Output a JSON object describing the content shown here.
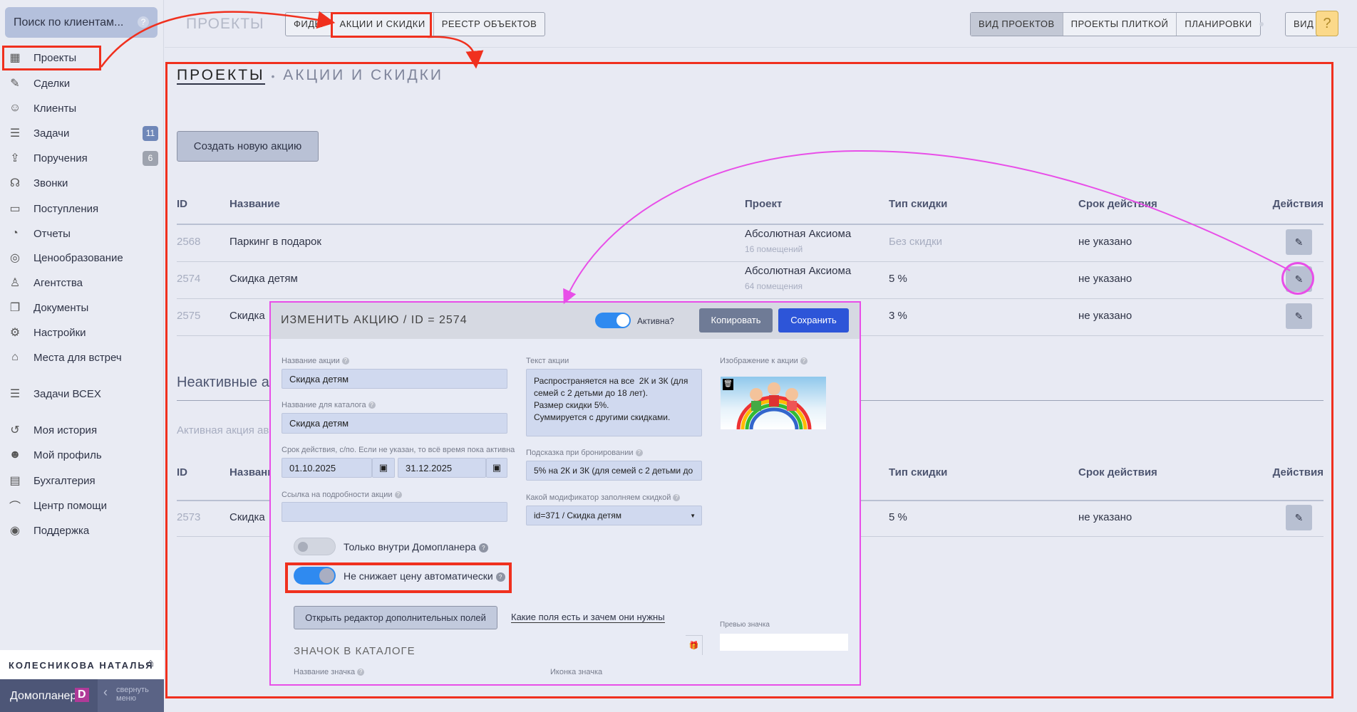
{
  "sidebar": {
    "search_placeholder": "Поиск по клиентам...",
    "items": [
      {
        "label": "Проекты",
        "icon": "building-icon"
      },
      {
        "label": "Сделки",
        "icon": "deal-icon"
      },
      {
        "label": "Клиенты",
        "icon": "users-icon"
      },
      {
        "label": "Задачи",
        "icon": "tasks-icon",
        "badge": "11"
      },
      {
        "label": "Поручения",
        "icon": "upload-icon",
        "badge": "6"
      },
      {
        "label": "Звонки",
        "icon": "headset-icon"
      },
      {
        "label": "Поступления",
        "icon": "wallet-icon"
      },
      {
        "label": "Отчеты",
        "icon": "pie-chart-icon"
      },
      {
        "label": "Ценообразование",
        "icon": "coins-icon"
      },
      {
        "label": "Агентства",
        "icon": "agent-icon"
      },
      {
        "label": "Документы",
        "icon": "documents-icon"
      },
      {
        "label": "Настройки",
        "icon": "gear-icon"
      },
      {
        "label": "Места для встреч",
        "icon": "meeting-icon"
      },
      {
        "label": "Задачи ВСЕХ",
        "icon": "tasks-icon"
      },
      {
        "label": "Моя история",
        "icon": "history-icon"
      },
      {
        "label": "Мой профиль",
        "icon": "profile-icon"
      },
      {
        "label": "Бухгалтерия",
        "icon": "accounting-icon"
      },
      {
        "label": "Центр помощи",
        "icon": "graduation-icon"
      },
      {
        "label": "Поддержка",
        "icon": "lifebuoy-icon"
      }
    ],
    "user_name": "КОЛЕСНИКОВА НАТАЛЬЯ",
    "brand": "Домопланер",
    "brand_letter": "D",
    "collapse": "свернуть меню"
  },
  "topbar": {
    "section": "ПРОЕКТЫ",
    "tabs": [
      "ФИДЫ",
      "АКЦИИ И СКИДКИ",
      "РЕЕСТР ОБЪЕКТОВ"
    ],
    "view_tabs": [
      "ВИД ПРОЕКТОВ",
      "ПРОЕКТЫ ПЛИТКОЙ",
      "ПЛАНИРОВКИ"
    ],
    "view": "ВИД",
    "help": "?"
  },
  "page": {
    "breadcrumb_root": "ПРОЕКТЫ",
    "breadcrumb_sep": "•",
    "breadcrumb_current": "АКЦИИ И СКИДКИ",
    "create_button": "Создать новую акцию",
    "columns": [
      "ID",
      "Название",
      "Проект",
      "Тип скидки",
      "Срок действия",
      "Действия"
    ],
    "active_rows": [
      {
        "id": "2568",
        "name": "Паркинг в подарок",
        "project": "Абсолютная Аксиома",
        "units": "16 помещений",
        "type": "Без скидки",
        "term": "не указано"
      },
      {
        "id": "2574",
        "name": "Скидка детям",
        "project": "Абсолютная Аксиома",
        "units": "64 помещения",
        "type": "5 %",
        "term": "не указано"
      },
      {
        "id": "2575",
        "name": "Скидка",
        "project": "",
        "units": "",
        "type": "3 %",
        "term": "не указано"
      }
    ],
    "inactive_title": "Неактивные ак",
    "inactive_note": "Активная акция ав",
    "inactive_rows": [
      {
        "id": "2573",
        "name": "Скидка",
        "type": "5 %",
        "term": "не указано"
      }
    ]
  },
  "modal": {
    "title": "ИЗМЕНИТЬ АКЦИЮ / ID = 2574",
    "active_label": "Активна?",
    "active": true,
    "copy": "Копировать",
    "save": "Сохранить",
    "name_label": "Название акции",
    "name": "Скидка детям",
    "catalog_label": "Название для каталога",
    "catalog": "Скидка детям",
    "term_label": "Срок действия, с/по. Если не указан, то всё время пока активна",
    "date_from": "01.10.2025",
    "date_to": "31.12.2025",
    "link_label": "Ссылка на подробности акции",
    "link": "",
    "text_label": "Текст акции",
    "text": "Распространяется на все  2К и 3К (для семей с 2 детьми до 18 лет).\nРазмер скидки 5%.\nСуммируется с другими скидками.",
    "hint_label": "Подсказка при бронировании",
    "hint": "5% на 2К и 3К (для семей с 2 детьми до",
    "modifier_label": "Какой модификатор заполняем скидкой",
    "modifier": "id=371 / Скидка детям",
    "image_label": "Изображение к акции",
    "only_inside": "Только внутри Домопланера",
    "only_inside_on": false,
    "no_auto": "Не снижает цену автоматически",
    "no_auto_on": true,
    "extra_fields": "Открыть редактор дополнительных полей",
    "extra_link": "Какие поля есть и зачем они нужны",
    "badge_section": "ЗНАЧОК В КАТАЛОГЕ",
    "badge_name_label": "Название значка",
    "badge_icon_label": "Иконка значка",
    "preview_label": "Превью значка"
  },
  "colors": {
    "annotation_red": "#f0301e",
    "annotation_pink": "#e84ee8",
    "save": "#2d55d8",
    "toggle": "#2f8af0"
  }
}
